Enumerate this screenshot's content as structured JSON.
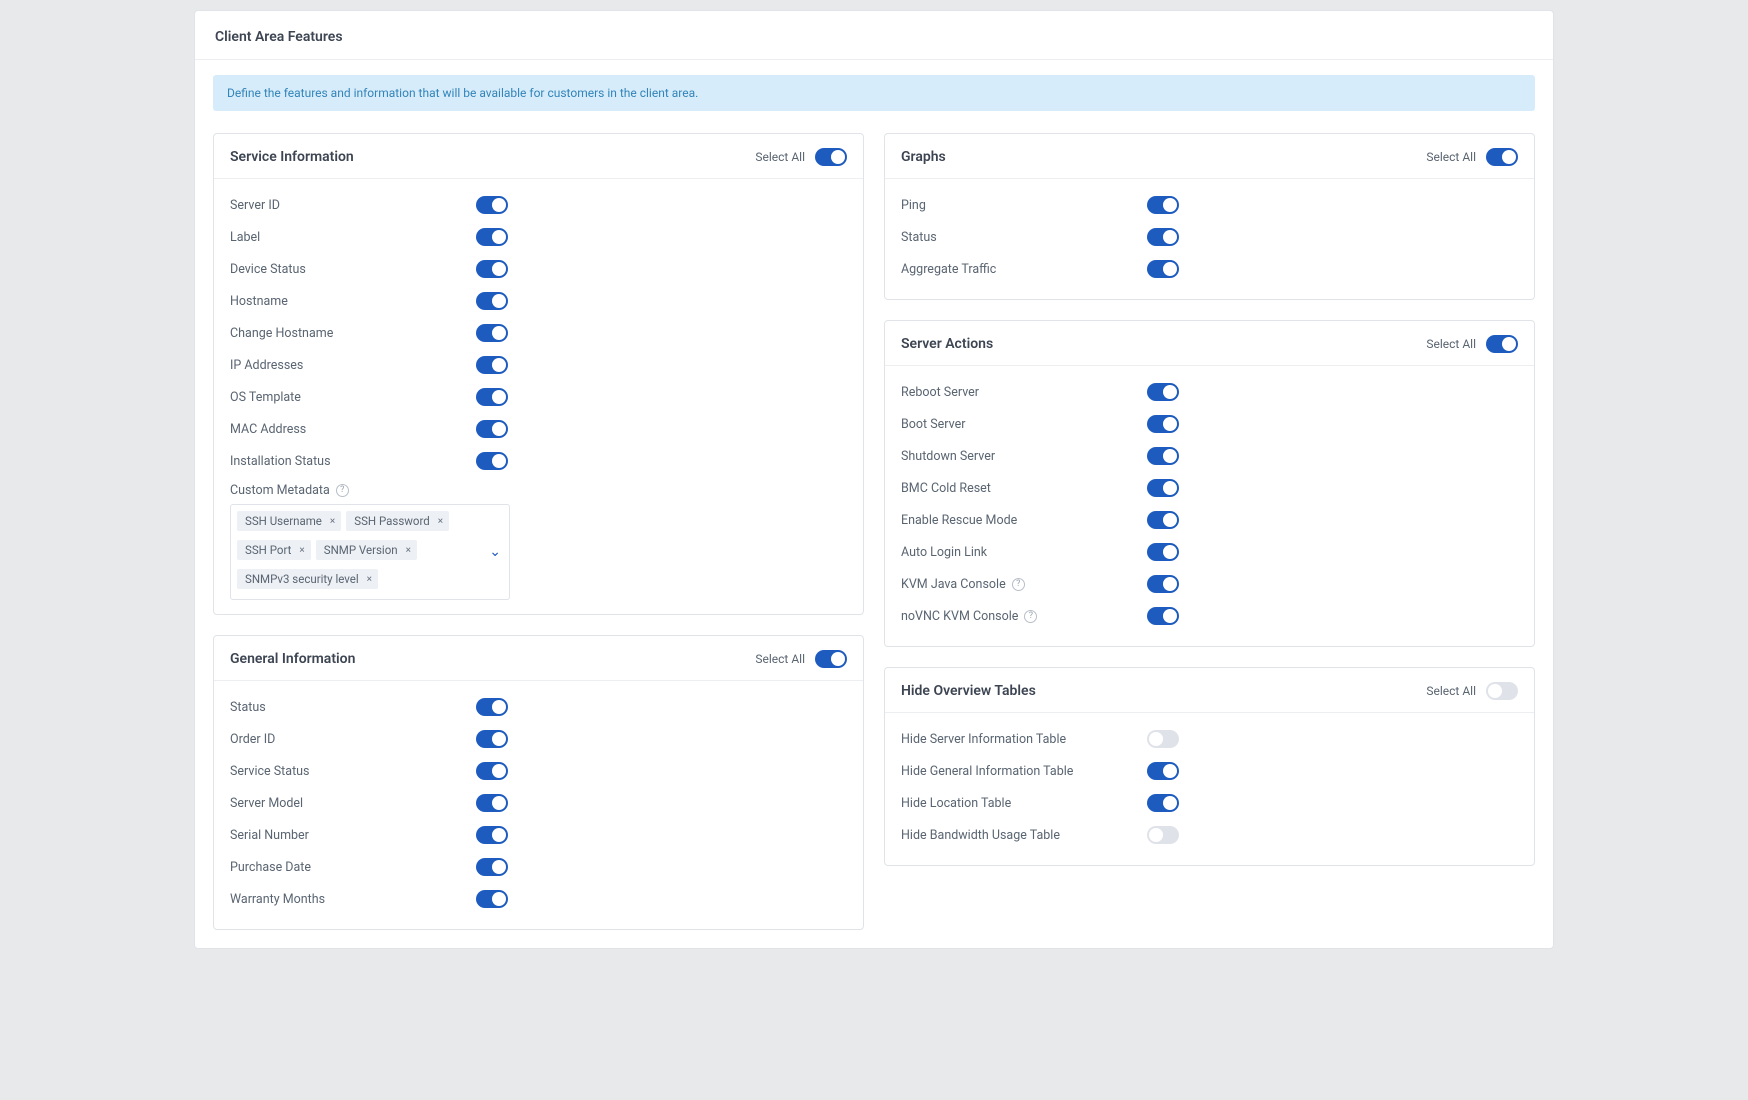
{
  "header": "Client Area Features",
  "info": "Define the features and information that will be available for customers in the client area.",
  "select_all": "Select All",
  "help_glyph": "?",
  "x_glyph": "×",
  "chevron_glyph": "⌄",
  "panels": {
    "service_info": {
      "title": "Service Information",
      "select_all_on": true,
      "items": [
        {
          "label": "Server ID",
          "on": true
        },
        {
          "label": "Label",
          "on": true
        },
        {
          "label": "Device Status",
          "on": true
        },
        {
          "label": "Hostname",
          "on": true
        },
        {
          "label": "Change Hostname",
          "on": true
        },
        {
          "label": "IP Addresses",
          "on": true
        },
        {
          "label": "OS Template",
          "on": true
        },
        {
          "label": "MAC Address",
          "on": true
        },
        {
          "label": "Installation Status",
          "on": true
        }
      ],
      "metadata_label": "Custom Metadata",
      "tags": [
        {
          "text": "SSH Username"
        },
        {
          "text": "SSH Password"
        },
        {
          "text": "SSH Port"
        },
        {
          "text": "SNMP Version"
        },
        {
          "text": "SNMPv3 security level"
        }
      ]
    },
    "general_info": {
      "title": "General Information",
      "select_all_on": true,
      "items": [
        {
          "label": "Status",
          "on": true
        },
        {
          "label": "Order ID",
          "on": true
        },
        {
          "label": "Service Status",
          "on": true
        },
        {
          "label": "Server Model",
          "on": true
        },
        {
          "label": "Serial Number",
          "on": true
        },
        {
          "label": "Purchase Date",
          "on": true
        },
        {
          "label": "Warranty Months",
          "on": true
        }
      ]
    },
    "graphs": {
      "title": "Graphs",
      "select_all_on": true,
      "items": [
        {
          "label": "Ping",
          "on": true
        },
        {
          "label": "Status",
          "on": true
        },
        {
          "label": "Aggregate Traffic",
          "on": true
        }
      ]
    },
    "server_actions": {
      "title": "Server Actions",
      "select_all_on": true,
      "items": [
        {
          "label": "Reboot Server",
          "on": true
        },
        {
          "label": "Boot Server",
          "on": true
        },
        {
          "label": "Shutdown Server",
          "on": true
        },
        {
          "label": "BMC Cold Reset",
          "on": true
        },
        {
          "label": "Enable Rescue Mode",
          "on": true
        },
        {
          "label": "Auto Login Link",
          "on": true
        },
        {
          "label": "KVM Java Console",
          "on": true,
          "help": true
        },
        {
          "label": "noVNC KVM Console",
          "on": true,
          "help": true
        }
      ]
    },
    "hide_overview": {
      "title": "Hide Overview Tables",
      "select_all_on": false,
      "items": [
        {
          "label": "Hide Server Information Table",
          "on": false
        },
        {
          "label": "Hide General Information Table",
          "on": true
        },
        {
          "label": "Hide Location Table",
          "on": true
        },
        {
          "label": "Hide Bandwidth Usage Table",
          "on": false
        }
      ]
    }
  }
}
